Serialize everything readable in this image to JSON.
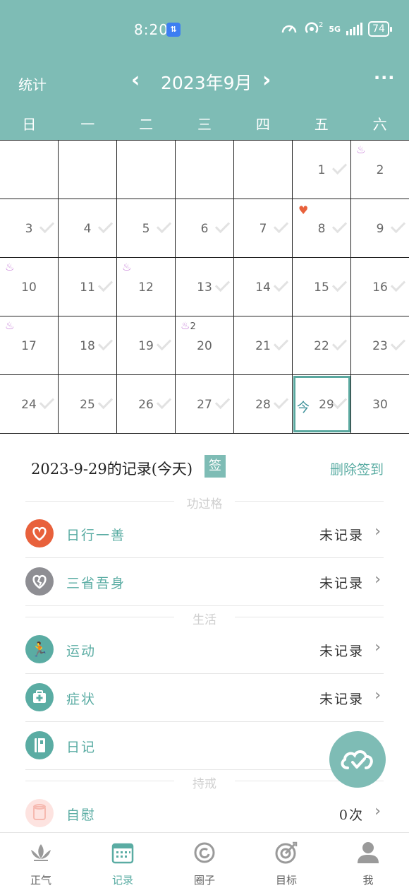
{
  "status_bar": {
    "time": "8:20",
    "network_badge": "⇅",
    "network": "5G",
    "signal_sup": "2",
    "battery": "74"
  },
  "header": {
    "stats_label": "统计",
    "month_title": "2023年9月",
    "more_label": "···"
  },
  "weekdays": [
    "日",
    "一",
    "二",
    "三",
    "四",
    "五",
    "六"
  ],
  "calendar": {
    "weeks": [
      [
        "",
        "",
        "",
        "",
        "",
        "1",
        "2"
      ],
      [
        "3",
        "4",
        "5",
        "6",
        "7",
        "8",
        "9"
      ],
      [
        "10",
        "11",
        "12",
        "13",
        "14",
        "15",
        "16"
      ],
      [
        "17",
        "18",
        "19",
        "20",
        "21",
        "22",
        "23"
      ],
      [
        "24",
        "25",
        "26",
        "27",
        "28",
        "29",
        "30"
      ]
    ],
    "today_label": "今",
    "pray_count_20": "2"
  },
  "record": {
    "title": "2023-9-29的记录(今天)",
    "sign_tag": "签",
    "delete_label": "删除签到",
    "section_merit": "功过格",
    "section_life": "生活",
    "section_precept": "持戒",
    "items": [
      {
        "label": "日行一善",
        "status": "未记录"
      },
      {
        "label": "三省吾身",
        "status": "未记录"
      },
      {
        "label": "运动",
        "status": "未记录"
      },
      {
        "label": "症状",
        "status": "未记录"
      },
      {
        "label": "日记",
        "status": "未"
      },
      {
        "label": "自慰",
        "status": "0次"
      }
    ]
  },
  "bottom_nav": {
    "tabs": [
      {
        "label": "正气",
        "icon": "lotus-icon"
      },
      {
        "label": "记录",
        "icon": "calendar-icon"
      },
      {
        "label": "圈子",
        "icon": "circle-icon"
      },
      {
        "label": "目标",
        "icon": "target-icon"
      },
      {
        "label": "我",
        "icon": "person-icon"
      }
    ],
    "active_index": 1
  },
  "colors": {
    "primary": "#7ebcb5",
    "accent": "#5aaca3",
    "heart": "#e8613c",
    "pray": "#c77fd8",
    "gray_icon": "#8e8e93"
  }
}
